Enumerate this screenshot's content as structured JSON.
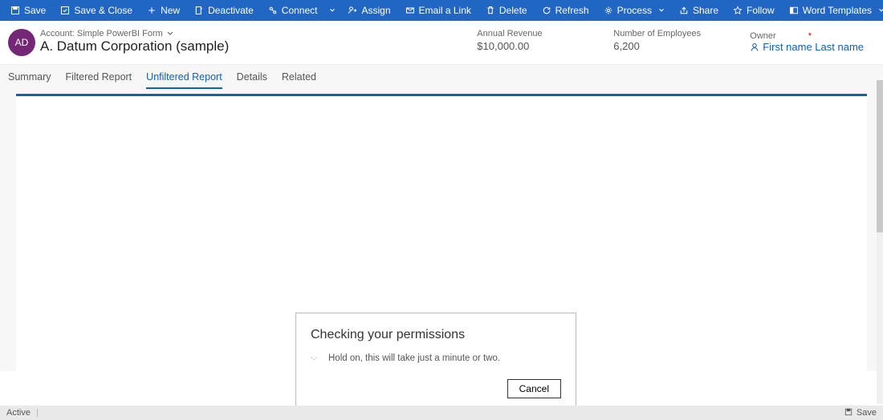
{
  "toolbar": {
    "save": "Save",
    "save_close": "Save & Close",
    "new": "New",
    "deactivate": "Deactivate",
    "connect": "Connect",
    "assign": "Assign",
    "email_link": "Email a Link",
    "delete": "Delete",
    "refresh": "Refresh",
    "process": "Process",
    "share": "Share",
    "follow": "Follow",
    "word_templates": "Word Templates"
  },
  "header": {
    "avatar_initials": "AD",
    "breadcrumb": "Account: Simple PowerBI Form",
    "record_name": "A. Datum Corporation (sample)",
    "fields": {
      "annual_revenue": {
        "label": "Annual Revenue",
        "value": "$10,000.00"
      },
      "employees": {
        "label": "Number of Employees",
        "value": "6,200"
      },
      "owner": {
        "label": "Owner",
        "value": "First name Last name"
      }
    }
  },
  "tabs": {
    "summary": "Summary",
    "filtered": "Filtered Report",
    "unfiltered": "Unfiltered Report",
    "details": "Details",
    "related": "Related"
  },
  "dialog": {
    "title": "Checking your permissions",
    "message": "Hold on, this will take just a minute or two.",
    "cancel": "Cancel"
  },
  "status": {
    "left": "Active",
    "right": "Save"
  }
}
